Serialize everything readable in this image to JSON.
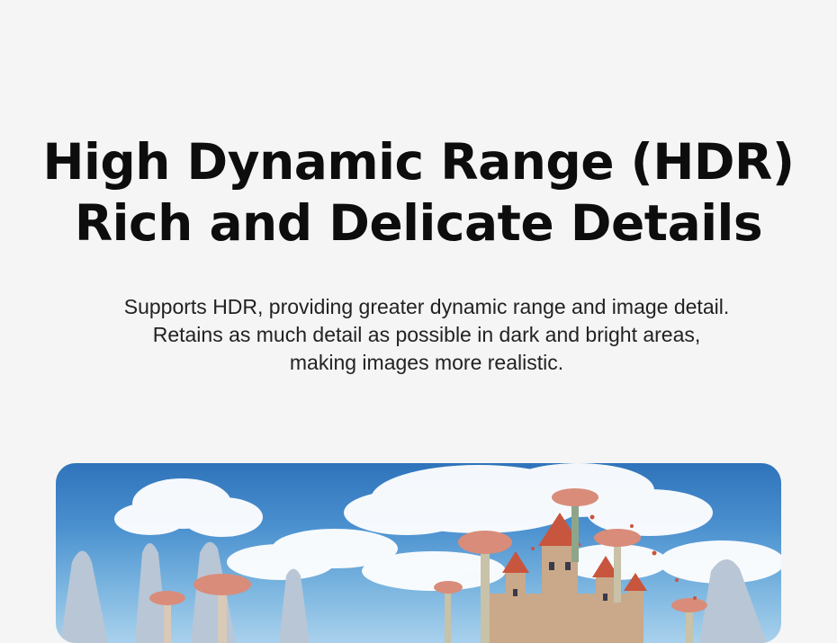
{
  "headline": {
    "line1": "High Dynamic Range (HDR)",
    "line2": "Rich and Delicate Details"
  },
  "description": {
    "line1": "Supports HDR, providing greater dynamic range and image detail.",
    "line2": "Retains as much detail as possible in dark and bright areas,",
    "line3": "making images more realistic."
  },
  "hero_image": {
    "subject": "fantasy-castle-with-mushroom-towers-landscape",
    "colors": {
      "sky_top": "#2f73ba",
      "sky_bottom": "#a9d1ec",
      "cloud": "#ffffff",
      "rock": "#b9c6d6",
      "mushroom_cap": "#d98c7a",
      "castle_roof": "#c8553d",
      "castle_wall": "#c9a98a"
    }
  }
}
